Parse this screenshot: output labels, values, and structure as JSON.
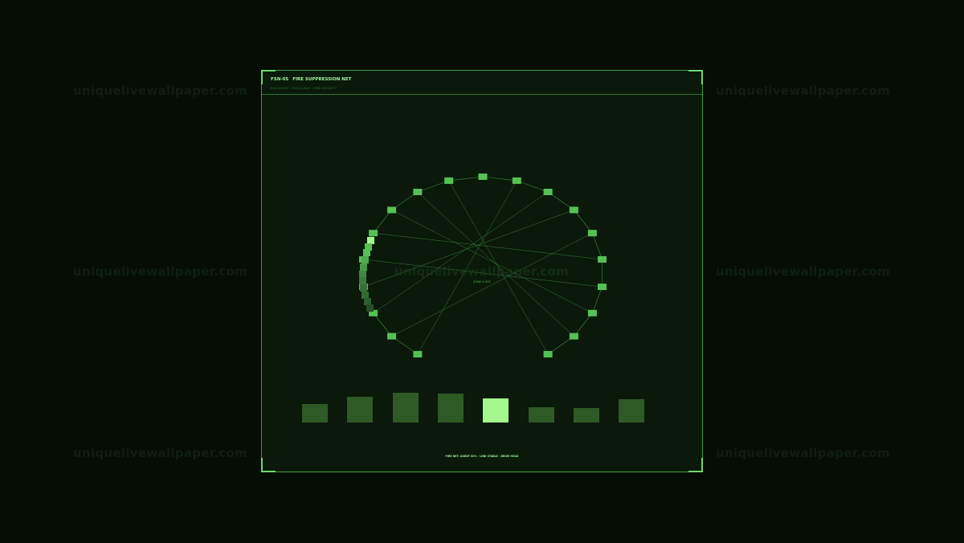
{
  "panel": {
    "title_code": "FSN-05",
    "title": "FIRE SUPPRESSION NET",
    "subtitle": "RING NODES · CROSS LINKS · ZONE INTENSITY",
    "center_label": "ZONE 4 HOT",
    "footer": "FIRE NET: AGENT 62% · LINK STABLE · DRIVE HOLD"
  },
  "watermark": "uniquelivewallpaper.com",
  "colors": {
    "background": "#050d05",
    "panel": "#0a190a",
    "accent": "#6fd86f",
    "node": "#55c155",
    "active": "#a3f78c",
    "bar": "#2d5a25"
  },
  "ring_nodes": 22,
  "zone_intensity": [
    0.3,
    0.42,
    0.49,
    0.48,
    0.4,
    0.25,
    0.24,
    0.39
  ],
  "active_zone_index": 4
}
